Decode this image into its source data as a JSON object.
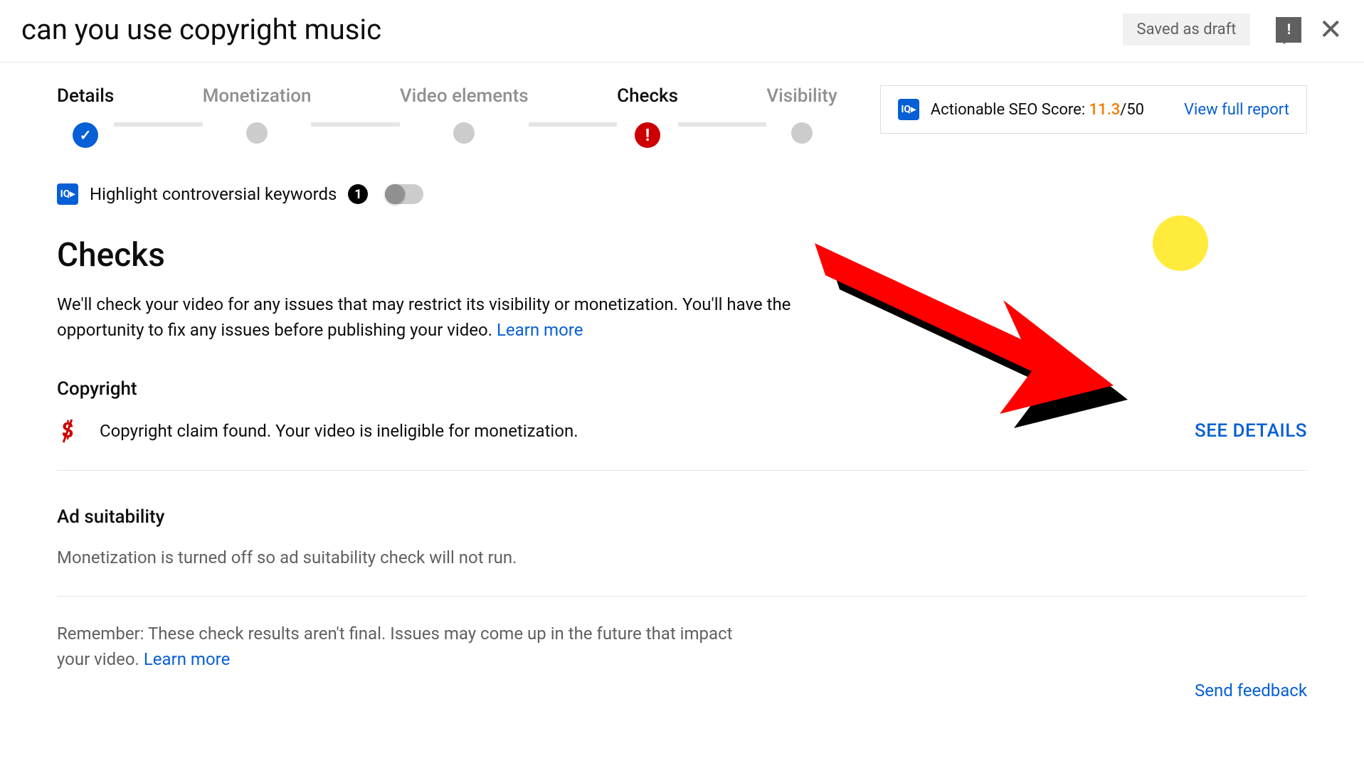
{
  "header": {
    "title": "can you use copyright music",
    "draft_badge": "Saved as draft"
  },
  "stepper": {
    "steps": [
      {
        "label": "Details"
      },
      {
        "label": "Monetization"
      },
      {
        "label": "Video elements"
      },
      {
        "label": "Checks"
      },
      {
        "label": "Visibility"
      }
    ]
  },
  "seo": {
    "label_prefix": "Actionable SEO Score: ",
    "score": "11.3",
    "score_suffix": "/50",
    "report_link": "View full report",
    "icon_text": "IQ▸"
  },
  "toggle": {
    "label": "Highlight controversial keywords",
    "count": "1"
  },
  "checks": {
    "title": "Checks",
    "description": "We'll check your video for any issues that may restrict its visibility or monetization. You'll have the opportunity to fix any issues before publishing your video. ",
    "learn_more": "Learn more",
    "copyright_heading": "Copyright",
    "copyright_text": "Copyright claim found. Your video is ineligible for monetization.",
    "see_details": "SEE DETAILS",
    "ad_heading": "Ad suitability",
    "ad_text": "Monetization is turned off so ad suitability check will not run.",
    "footnote": "Remember: These check results aren't final. Issues may come up in the future that impact your video. ",
    "footnote_link": "Learn more",
    "send_feedback": "Send feedback"
  }
}
